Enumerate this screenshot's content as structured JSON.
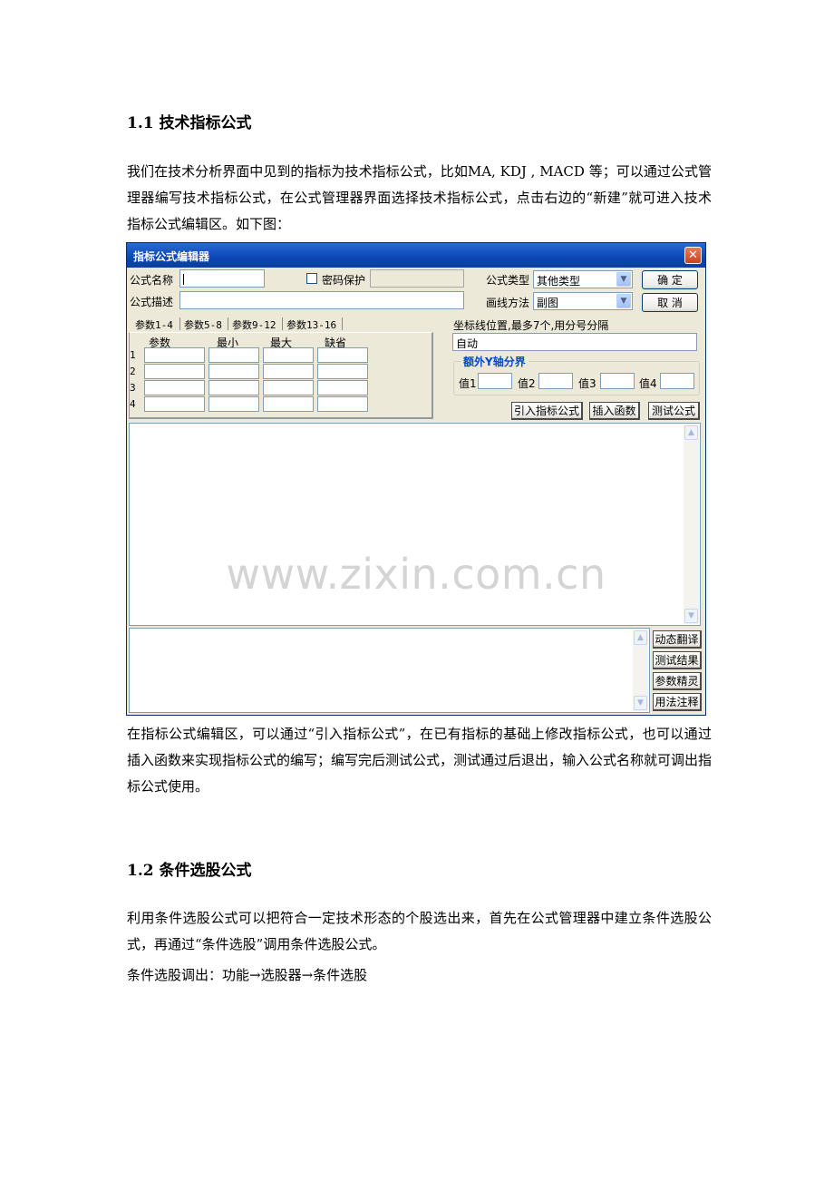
{
  "section1": {
    "heading": "1.1 技术指标公式",
    "para1": "我们在技术分析界面中见到的指标为技术指标公式，比如MA,   KDJ , MACD   等；可以通过公式管理器编写技术指标公式，在公式管理器界面选择技术指标公式，点击右边的“新建”就可进入技术指标公式编辑区。如下图：",
    "para2": "在指标公式编辑区，可以通过“引入指标公式”，在已有指标的基础上修改指标公式，也可以通过插入函数来实现指标公式的编写；编写完后测试公式，测试通过后退出，输入公式名称就可调出指标公式使用。"
  },
  "dialog": {
    "title": "指标公式编辑器",
    "close_icon": "close-icon",
    "formula_name_label": "公式名称",
    "formula_desc_label": "公式描述",
    "password_label": "密码保护",
    "formula_type_label": "公式类型",
    "formula_type_value": "其他类型",
    "draw_method_label": "画线方法",
    "draw_method_value": "副图",
    "ok_label": "确  定",
    "cancel_label": "取  消",
    "tabs": [
      "参数1-4",
      "参数5-8",
      "参数9-12",
      "参数13-16"
    ],
    "param_columns": [
      "参数",
      "最小",
      "最大",
      "缺省"
    ],
    "row_numbers": [
      "1",
      "2",
      "3",
      "4"
    ],
    "axis_label": "坐标线位置,最多7个,用分号分隔",
    "axis_value": "自动",
    "y_group_title": "额外Y轴分界",
    "value_labels": [
      "值1",
      "值2",
      "值3",
      "值4"
    ],
    "import_button": "引入指标公式",
    "insert_function_button": "插入函数",
    "test_formula_button": "测试公式",
    "side_buttons": [
      "动态翻译",
      "测试结果",
      "参数精灵",
      "用法注释"
    ],
    "watermark": "www.zixin.com.cn"
  },
  "section2": {
    "heading": "1.2 条件选股公式",
    "para1": "利用条件选股公式可以把符合一定技术形态的个股选出来，首先在公式管理器中建立条件选股公式，再通过“条件选股”调用条件选股公式。",
    "line2": "条件选股调出：功能→选股器→条件选股"
  }
}
